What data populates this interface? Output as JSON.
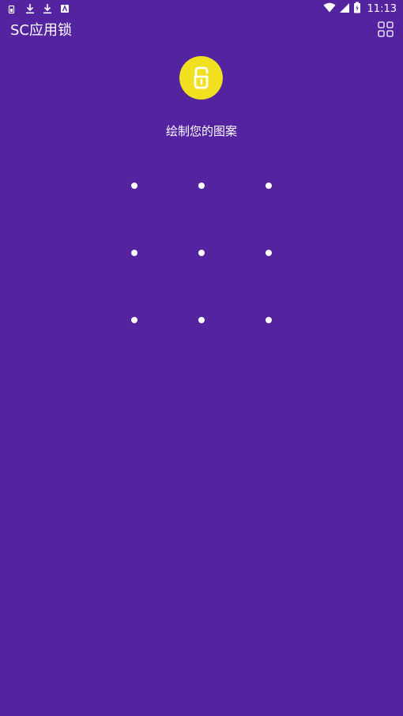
{
  "status_bar": {
    "time": "11:13",
    "left_icons": [
      "sim-icon",
      "download-icon",
      "download-icon",
      "app-notification-icon"
    ],
    "right_icons": [
      "wifi-icon",
      "signal-icon",
      "battery-charging-icon"
    ]
  },
  "app_bar": {
    "title": "SC应用锁",
    "menu_icon": "grid-icon"
  },
  "logo": {
    "icon": "lock-logo-icon",
    "color": "#f0e020"
  },
  "prompt": "绘制您的图案",
  "pattern": {
    "rows": 3,
    "cols": 3,
    "dot_color": "#ffffff"
  },
  "colors": {
    "background": "#5424a0",
    "accent": "#f0e020"
  }
}
